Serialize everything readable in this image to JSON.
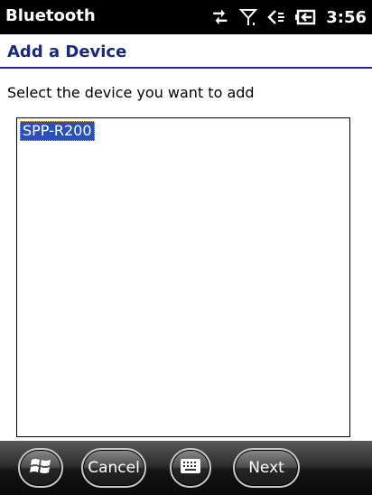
{
  "titlebar": {
    "app_title": "Bluetooth",
    "time": "3:56",
    "icons": [
      "data-connection-icon",
      "signal-antenna-icon",
      "speaker-volume-icon",
      "battery-charging-icon"
    ]
  },
  "header": {
    "title": "Add a Device"
  },
  "instruction": "Select the device you want to add",
  "device_list": {
    "items": [
      "SPP-R200"
    ],
    "selected_index": 0
  },
  "softkeys": {
    "start_icon": "windows-start-icon",
    "cancel_label": "Cancel",
    "keyboard_icon": "keyboard-icon",
    "next_label": "Next"
  },
  "colors": {
    "title_text": "#1a2a7a",
    "selection": "#2d4fb8",
    "bar": "#000000"
  }
}
